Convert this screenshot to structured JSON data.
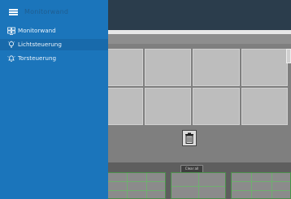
{
  "drawer": {
    "title": "Monitorwand",
    "items": [
      {
        "label": "Monitorwand",
        "icon": "monitor-grid-icon",
        "active": false
      },
      {
        "label": "Lichtsteuerung",
        "icon": "lightbulb-icon",
        "active": true
      },
      {
        "label": "Torsteuerung",
        "icon": "bell-icon",
        "active": false
      }
    ]
  },
  "main": {
    "clear_button_label": "Clear all",
    "trash_icon": "trash-icon"
  },
  "colors": {
    "drawer_bg": "#1b75bb",
    "active_item_bg": "#186aab",
    "topbar_bg": "#2b3d4c",
    "monitor_border": "#4b8f4b"
  }
}
